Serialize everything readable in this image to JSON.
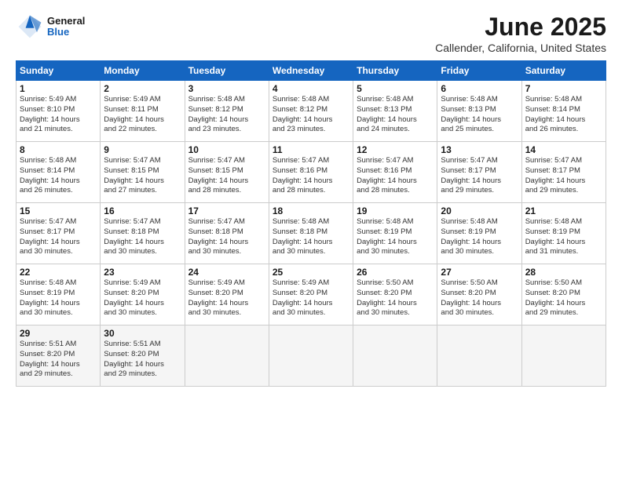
{
  "header": {
    "title": "June 2025",
    "location": "Callender, California, United States",
    "logo_general": "General",
    "logo_blue": "Blue"
  },
  "weekdays": [
    "Sunday",
    "Monday",
    "Tuesday",
    "Wednesday",
    "Thursday",
    "Friday",
    "Saturday"
  ],
  "weeks": [
    [
      {
        "day": "1",
        "info": "Sunrise: 5:49 AM\nSunset: 8:10 PM\nDaylight: 14 hours\nand 21 minutes."
      },
      {
        "day": "2",
        "info": "Sunrise: 5:49 AM\nSunset: 8:11 PM\nDaylight: 14 hours\nand 22 minutes."
      },
      {
        "day": "3",
        "info": "Sunrise: 5:48 AM\nSunset: 8:12 PM\nDaylight: 14 hours\nand 23 minutes."
      },
      {
        "day": "4",
        "info": "Sunrise: 5:48 AM\nSunset: 8:12 PM\nDaylight: 14 hours\nand 23 minutes."
      },
      {
        "day": "5",
        "info": "Sunrise: 5:48 AM\nSunset: 8:13 PM\nDaylight: 14 hours\nand 24 minutes."
      },
      {
        "day": "6",
        "info": "Sunrise: 5:48 AM\nSunset: 8:13 PM\nDaylight: 14 hours\nand 25 minutes."
      },
      {
        "day": "7",
        "info": "Sunrise: 5:48 AM\nSunset: 8:14 PM\nDaylight: 14 hours\nand 26 minutes."
      }
    ],
    [
      {
        "day": "8",
        "info": "Sunrise: 5:48 AM\nSunset: 8:14 PM\nDaylight: 14 hours\nand 26 minutes."
      },
      {
        "day": "9",
        "info": "Sunrise: 5:47 AM\nSunset: 8:15 PM\nDaylight: 14 hours\nand 27 minutes."
      },
      {
        "day": "10",
        "info": "Sunrise: 5:47 AM\nSunset: 8:15 PM\nDaylight: 14 hours\nand 28 minutes."
      },
      {
        "day": "11",
        "info": "Sunrise: 5:47 AM\nSunset: 8:16 PM\nDaylight: 14 hours\nand 28 minutes."
      },
      {
        "day": "12",
        "info": "Sunrise: 5:47 AM\nSunset: 8:16 PM\nDaylight: 14 hours\nand 28 minutes."
      },
      {
        "day": "13",
        "info": "Sunrise: 5:47 AM\nSunset: 8:17 PM\nDaylight: 14 hours\nand 29 minutes."
      },
      {
        "day": "14",
        "info": "Sunrise: 5:47 AM\nSunset: 8:17 PM\nDaylight: 14 hours\nand 29 minutes."
      }
    ],
    [
      {
        "day": "15",
        "info": "Sunrise: 5:47 AM\nSunset: 8:17 PM\nDaylight: 14 hours\nand 30 minutes."
      },
      {
        "day": "16",
        "info": "Sunrise: 5:47 AM\nSunset: 8:18 PM\nDaylight: 14 hours\nand 30 minutes."
      },
      {
        "day": "17",
        "info": "Sunrise: 5:47 AM\nSunset: 8:18 PM\nDaylight: 14 hours\nand 30 minutes."
      },
      {
        "day": "18",
        "info": "Sunrise: 5:48 AM\nSunset: 8:18 PM\nDaylight: 14 hours\nand 30 minutes."
      },
      {
        "day": "19",
        "info": "Sunrise: 5:48 AM\nSunset: 8:19 PM\nDaylight: 14 hours\nand 30 minutes."
      },
      {
        "day": "20",
        "info": "Sunrise: 5:48 AM\nSunset: 8:19 PM\nDaylight: 14 hours\nand 30 minutes."
      },
      {
        "day": "21",
        "info": "Sunrise: 5:48 AM\nSunset: 8:19 PM\nDaylight: 14 hours\nand 31 minutes."
      }
    ],
    [
      {
        "day": "22",
        "info": "Sunrise: 5:48 AM\nSunset: 8:19 PM\nDaylight: 14 hours\nand 30 minutes."
      },
      {
        "day": "23",
        "info": "Sunrise: 5:49 AM\nSunset: 8:20 PM\nDaylight: 14 hours\nand 30 minutes."
      },
      {
        "day": "24",
        "info": "Sunrise: 5:49 AM\nSunset: 8:20 PM\nDaylight: 14 hours\nand 30 minutes."
      },
      {
        "day": "25",
        "info": "Sunrise: 5:49 AM\nSunset: 8:20 PM\nDaylight: 14 hours\nand 30 minutes."
      },
      {
        "day": "26",
        "info": "Sunrise: 5:50 AM\nSunset: 8:20 PM\nDaylight: 14 hours\nand 30 minutes."
      },
      {
        "day": "27",
        "info": "Sunrise: 5:50 AM\nSunset: 8:20 PM\nDaylight: 14 hours\nand 30 minutes."
      },
      {
        "day": "28",
        "info": "Sunrise: 5:50 AM\nSunset: 8:20 PM\nDaylight: 14 hours\nand 29 minutes."
      }
    ],
    [
      {
        "day": "29",
        "info": "Sunrise: 5:51 AM\nSunset: 8:20 PM\nDaylight: 14 hours\nand 29 minutes."
      },
      {
        "day": "30",
        "info": "Sunrise: 5:51 AM\nSunset: 8:20 PM\nDaylight: 14 hours\nand 29 minutes."
      },
      {
        "day": "",
        "info": ""
      },
      {
        "day": "",
        "info": ""
      },
      {
        "day": "",
        "info": ""
      },
      {
        "day": "",
        "info": ""
      },
      {
        "day": "",
        "info": ""
      }
    ]
  ]
}
